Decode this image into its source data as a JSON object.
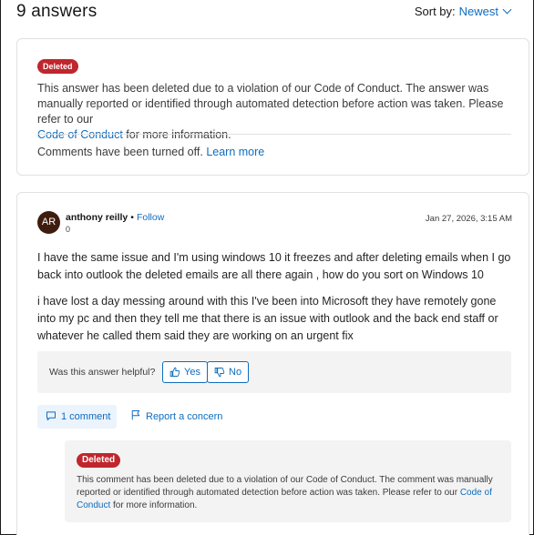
{
  "header": {
    "answers_title": "9 answers",
    "sort_label": "Sort by:",
    "sort_value": "Newest"
  },
  "deleted_answer": {
    "badge": "Deleted",
    "text": "This answer has been deleted due to a violation of our Code of Conduct. The answer was manually reported or identified through automated detection before action was taken. Please refer to our",
    "link": "Code of Conduct",
    "text_after": " for more information.",
    "comments_off": "Comments have been turned off.",
    "learn_more": "Learn more"
  },
  "answer": {
    "avatar_initials": "AR",
    "author": "anthony reilly",
    "separator": "•",
    "follow": "Follow",
    "reputation": "0",
    "date": "Jan 27, 2026, 3:15 AM",
    "paragraphs": [
      "I have the same issue and I'm using windows 10 it freezes and after deleting emails when I go back into outlook the deleted emails are all there again , how do you sort on Windows 10",
      "i have lost a day messing around with this I've been into Microsoft they have remotely gone into my pc and then they tell me that there is an issue with outlook and the back end staff or whatever he called them said they are working on an urgent fix"
    ],
    "helpful_label": "Was this answer helpful?",
    "yes": "Yes",
    "no": "No",
    "comment_count": "1 comment",
    "report": "Report a concern"
  },
  "deleted_comment": {
    "badge": "Deleted",
    "text": "This comment has been deleted due to a violation of our Code of Conduct. The comment was manually reported or identified through automated detection before action was taken. Please refer to our",
    "link": "Code of Conduct",
    "text_after": " for more information."
  },
  "colors": {
    "accent": "#0f6cbd",
    "deleted_badge": "#c0262d",
    "avatar": "#3e1d0f"
  }
}
